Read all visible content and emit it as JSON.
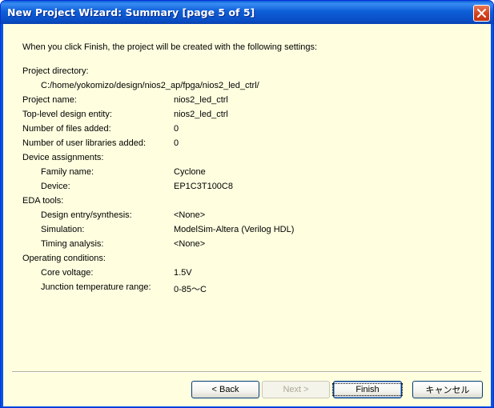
{
  "window": {
    "title": "New Project Wizard: Summary [page 5 of 5]"
  },
  "summary": {
    "intro": "When you click Finish, the project will be created with the following settings:",
    "project_directory_label": "Project directory:",
    "project_directory_value": "C:/home/yokomizo/design/nios2_ap/fpga/nios2_led_ctrl/",
    "project_name_label": "Project name:",
    "project_name_value": "nios2_led_ctrl",
    "top_level_label": "Top-level design entity:",
    "top_level_value": "nios2_led_ctrl",
    "files_added_label": "Number of files added:",
    "files_added_value": "0",
    "user_libraries_label": "Number of user libraries added:",
    "user_libraries_value": "0",
    "device_assignments_label": "Device assignments:",
    "family_name_label": "Family name:",
    "family_name_value": "Cyclone",
    "device_label": "Device:",
    "device_value": "EP1C3T100C8",
    "eda_tools_label": "EDA tools:",
    "design_entry_label": "Design entry/synthesis:",
    "design_entry_value": "<None>",
    "simulation_label": "Simulation:",
    "simulation_value": "ModelSim-Altera (Verilog HDL)",
    "timing_label": "Timing analysis:",
    "timing_value": "<None>",
    "operating_conditions_label": "Operating conditions:",
    "core_voltage_label": "Core voltage:",
    "core_voltage_value": "1.5V",
    "junction_temp_label": "Junction temperature range:",
    "junction_temp_value": "0-85〜C"
  },
  "buttons": {
    "back": "< Back",
    "next": "Next >",
    "finish": "Finish",
    "cancel": "キャンセル"
  },
  "colors": {
    "titlebar": "#0a50c8",
    "client_background": "#ffffe0",
    "close_button": "#d7441f"
  }
}
